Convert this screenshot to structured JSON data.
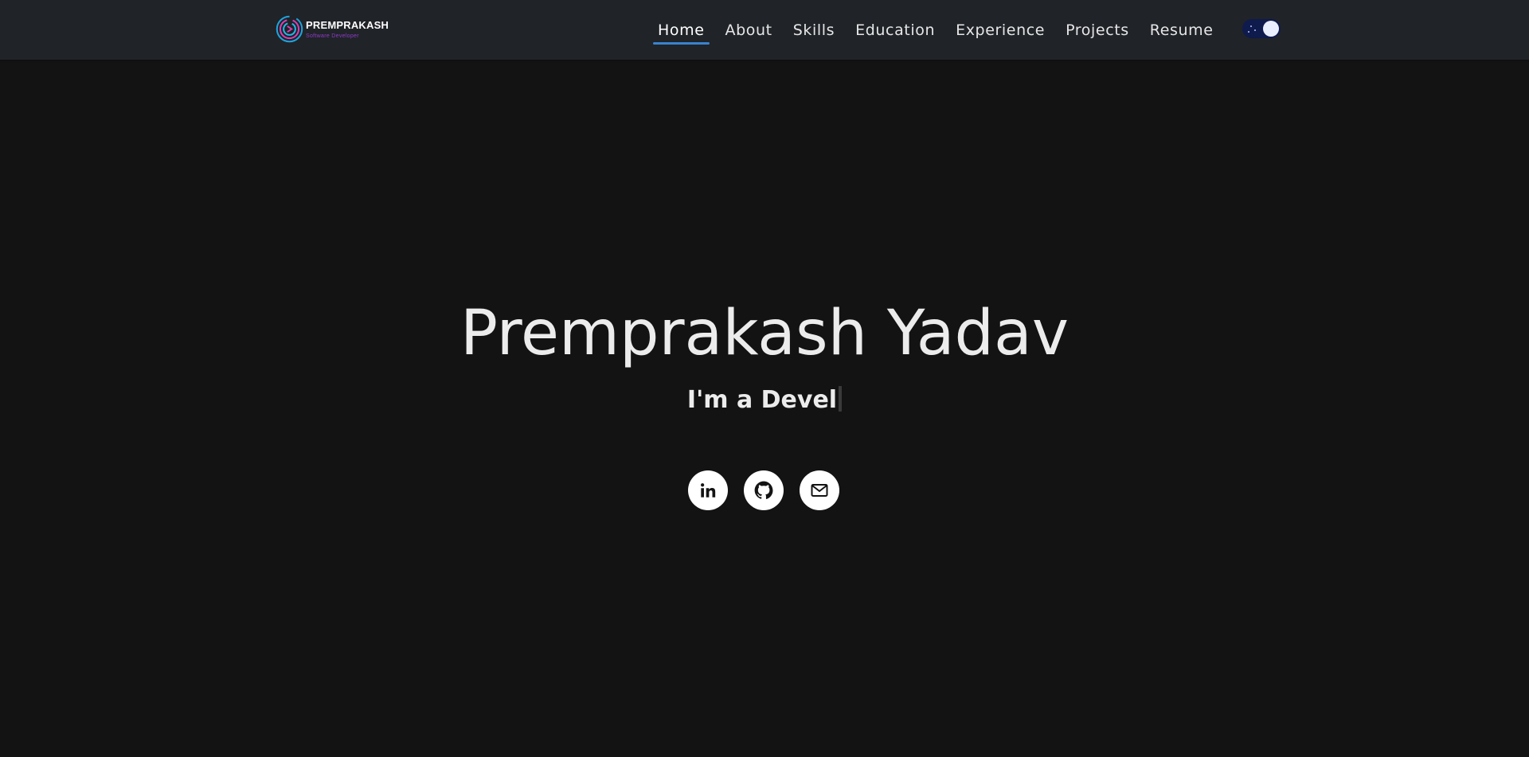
{
  "brand": {
    "name": "PREMPRAKASH",
    "tagline": "Software Developer",
    "ring_colors": [
      "#22b5e8",
      "#d63fb6",
      "#1fa3dc"
    ]
  },
  "nav": {
    "items": [
      {
        "label": "Home",
        "active": true
      },
      {
        "label": "About",
        "active": false
      },
      {
        "label": "Skills",
        "active": false
      },
      {
        "label": "Education",
        "active": false
      },
      {
        "label": "Experience",
        "active": false
      },
      {
        "label": "Projects",
        "active": false
      },
      {
        "label": "Resume",
        "active": false
      }
    ],
    "active_underline_color": "#3a83cf"
  },
  "theme_toggle": {
    "state": "dark",
    "track_color": "#0f1a4d",
    "knob_color": "#e9efff"
  },
  "hero": {
    "name": "Premprakash Yadav",
    "subtitle_prefix": "I'm a ",
    "subtitle_typed": "Devel"
  },
  "socials": [
    {
      "icon": "linkedin-icon"
    },
    {
      "icon": "github-icon"
    },
    {
      "icon": "mail-icon"
    }
  ],
  "colors": {
    "background": "#131313",
    "navbar": "#202328",
    "text": "#ececec"
  }
}
